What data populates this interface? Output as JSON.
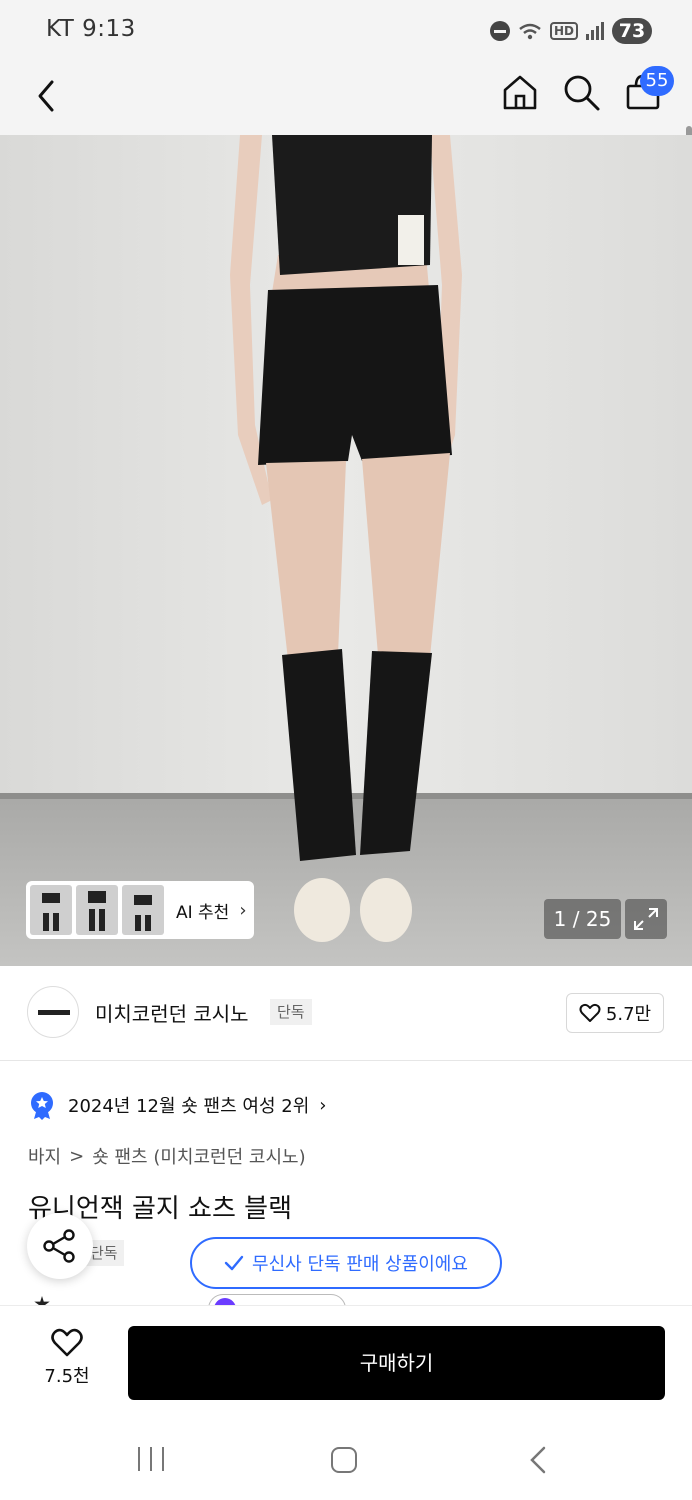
{
  "status_bar": {
    "carrier_time": "KT 9:13",
    "battery": "73",
    "hd": "HD"
  },
  "nav": {
    "cart_count": "55"
  },
  "gallery": {
    "ai_recommend": "AI 추천",
    "counter": "1 / 25"
  },
  "brand": {
    "name": "미치코런던 코시노",
    "tag": "단독",
    "likes": "5.7만"
  },
  "ranking": {
    "text": "2024년 12월 숏 팬츠 여성 2위"
  },
  "breadcrumb": {
    "category": "바지",
    "separator": ">",
    "subcategory": "숏 팬츠 (미치코런던 코시노)"
  },
  "product": {
    "title": "유니언잭 골지 쇼츠 블랙",
    "exclusive_tag": "단독"
  },
  "toast": {
    "text": "무신사 단독 판매 상품이에요"
  },
  "purchase_bar": {
    "wish_count": "7.5천",
    "buy_label": "구매하기"
  },
  "colors": {
    "accent_blue": "#2f6bff",
    "buy_button": "#000000",
    "header_bg": "#f4f4f4"
  },
  "icons": [
    "back-icon",
    "home-icon",
    "search-icon",
    "shopping-bag-icon",
    "expand-icon",
    "heart-icon",
    "rank-badge-icon",
    "share-icon",
    "check-icon"
  ]
}
